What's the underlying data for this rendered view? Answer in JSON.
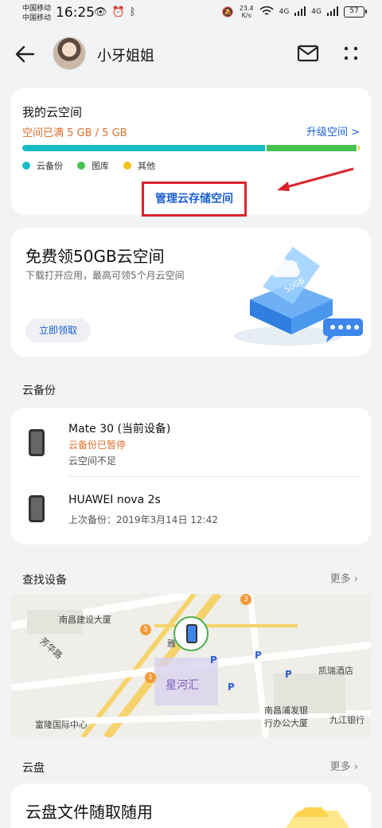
{
  "status": {
    "carrier1": "中国移动",
    "carrier2": "中国移动",
    "time": "16:25",
    "speed_value": "23.4",
    "speed_unit": "K/s",
    "network1": "4G",
    "network2": "4G",
    "battery": "57"
  },
  "header": {
    "name": "小牙姐姐"
  },
  "storage": {
    "title": "我的云空间",
    "usage": "空间已满 5 GB / 5 GB",
    "upgrade": "升级空间 >",
    "segments": [
      {
        "name": "云备份",
        "fraction": 0.72,
        "color": "#17bcc6"
      },
      {
        "name": "图库",
        "fraction": 0.27,
        "color": "#45c24f"
      },
      {
        "name": "其他",
        "fraction": 0.01,
        "color": "#f3c21f"
      }
    ],
    "manage": "管理云存储空间"
  },
  "promo": {
    "title": "免费领50GB云空间",
    "desc": "下载打开应用，最高可领5个月云空间",
    "button": "立即领取",
    "badge": "50GB"
  },
  "backup": {
    "title": "云备份",
    "devices": [
      {
        "name": "Mate 30 (当前设备)",
        "status": "云备份已暂停",
        "note": "云空间不足"
      },
      {
        "name": "HUAWEI nova 2s",
        "last": "上次备份：2019年3月14日 12:42"
      }
    ]
  },
  "find": {
    "title": "查找设备",
    "more": "更多",
    "map_labels": {
      "building1": "南昌建设大厦",
      "road1": "芳华路",
      "landmark": "星河汇",
      "hotel": "凯瑞酒店",
      "bank1": "南昌浦发银",
      "bank2": "行办公大厦",
      "bank3": "九江银行",
      "center": "富隆国际中心",
      "ya": "雅"
    }
  },
  "disk": {
    "title": "云盘",
    "more": "更多",
    "promo": "云盘文件随取随用"
  }
}
